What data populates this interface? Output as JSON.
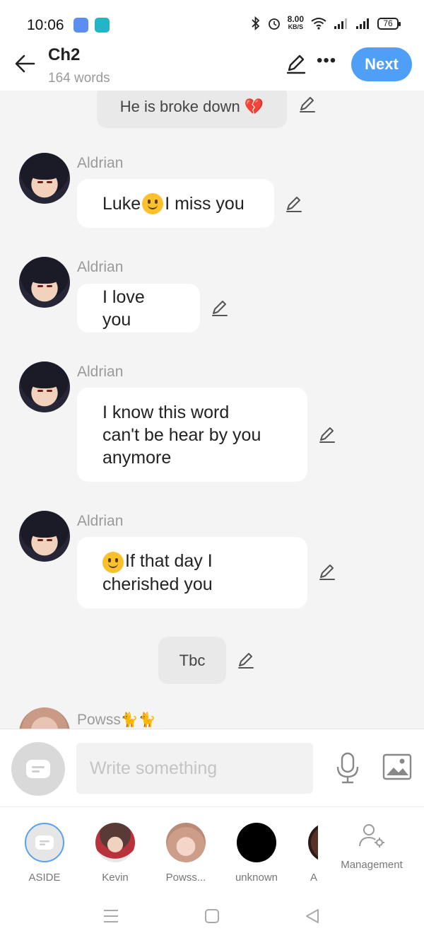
{
  "status_bar": {
    "time": "10:06",
    "net_speed": "8.00",
    "net_unit": "KB/S",
    "battery": "76",
    "icons": [
      "novel-toon-app-icon",
      "app-notification-icon",
      "bluetooth-icon",
      "alarm-icon",
      "wifi-icon",
      "signal-icon",
      "signal-icon",
      "battery-icon"
    ]
  },
  "header": {
    "title": "Ch2",
    "word_count": "164 words",
    "next_label": "Next",
    "icons": [
      "back-arrow-icon",
      "edit-pencil-icon",
      "more-dots-icon"
    ]
  },
  "chat": {
    "top_narration": "He is broke down 💔",
    "messages": [
      {
        "sender": "Aldrian",
        "text_a": "Luke ",
        "emoji": "smile",
        "text_b": "I miss you"
      },
      {
        "sender": "Aldrian",
        "text": "I love you"
      },
      {
        "sender": "Aldrian",
        "line1": "I know this word",
        "line2": "can't be hear by you",
        "line3": "anymore"
      },
      {
        "sender": "Aldrian",
        "emoji": "smile",
        "line1": "If that day I",
        "line2": "cherished you"
      }
    ],
    "tbc": "Tbc",
    "partial_sender": "Powss",
    "partial_sender_emoji": "🐈🐈"
  },
  "input": {
    "placeholder": "Write something",
    "icons": [
      "aside-chat-icon",
      "microphone-icon",
      "image-icon"
    ]
  },
  "characters": [
    {
      "name": "ASIDE",
      "selected": true
    },
    {
      "name": "Kevin"
    },
    {
      "name": "Powss..."
    },
    {
      "name": "unknown"
    },
    {
      "name": "A"
    }
  ],
  "management_label": "Management",
  "colors": {
    "accent": "#4e9ff5",
    "background": "#f4f4f4",
    "bubble": "#ffffff",
    "narration": "#e9e9e9",
    "muted_text": "#9a9a9a"
  }
}
